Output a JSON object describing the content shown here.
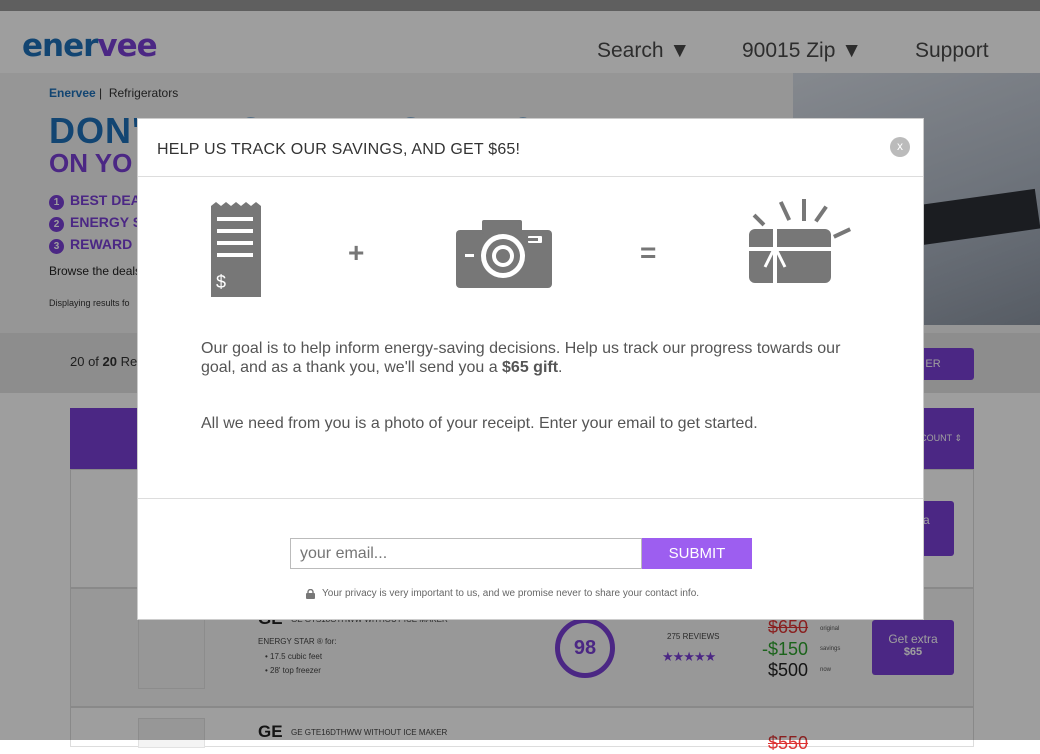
{
  "header": {
    "logo_part1": "ener",
    "logo_part2": "vee",
    "nav": {
      "search": "Search ▼",
      "zip": "90015 Zip ▼",
      "support": "Support"
    }
  },
  "hero": {
    "breadcrumb_home": "Enervee",
    "breadcrumb_sep": "|",
    "breadcrumb_current": "Refrigerators",
    "title_line1": "DON'T BE STUPID. SAVE ON",
    "title_line2": "ON YO",
    "bullets": [
      {
        "num": "1",
        "text": "BEST DEA"
      },
      {
        "num": "2",
        "text": "ENERGY S"
      },
      {
        "num": "3",
        "text": "REWARD"
      }
    ],
    "browse_text": "Browse the deals",
    "displaying_text": "Displaying results fo"
  },
  "filterbar": {
    "count_prefix": "20 of ",
    "count_bold": "20",
    "count_suffix": " Re",
    "filter_button": "ER"
  },
  "table": {
    "sort_label": "COUNT ⇕",
    "rows": [
      {
        "get_label": "t extra",
        "get_amount": ""
      },
      {
        "brand": "GE",
        "model": "GE GTS18GTHWW WITHOUT ICE MAKER",
        "energy_star": "ENERGY STAR ® for:",
        "features": [
          "17.5 cubic feet",
          "28' top freezer"
        ],
        "score": "98",
        "reviews": "275 REVIEWS",
        "stars": "★★★★★",
        "price_original": "$650",
        "price_savings": "-$150",
        "price_now": "$500",
        "label_original": "original",
        "label_savings": "savings",
        "label_now": "now",
        "get_label": "Get extra",
        "get_amount": "$65"
      },
      {
        "brand": "GE",
        "model": "GE GTE16DTHWW WITHOUT ICE MAKER",
        "price_original": "$550"
      }
    ]
  },
  "modal": {
    "title": "HELP US TRACK OUR SAVINGS, AND GET $65!",
    "close": "x",
    "receipt_symbol": "$",
    "plus": "+",
    "equals": "=",
    "p1_text": "Our goal is to help inform energy-saving decisions. Help us track our progress towards our goal, and as a thank you, we'll send you a ",
    "p1_bold": "$65 gift",
    "p1_end": ".",
    "p2": "All we need from you is a photo of your receipt. Enter your email to get started.",
    "email_placeholder": "your email...",
    "submit": "SUBMIT",
    "privacy": "Your privacy is very important to us, and we promise never to share your contact info."
  }
}
